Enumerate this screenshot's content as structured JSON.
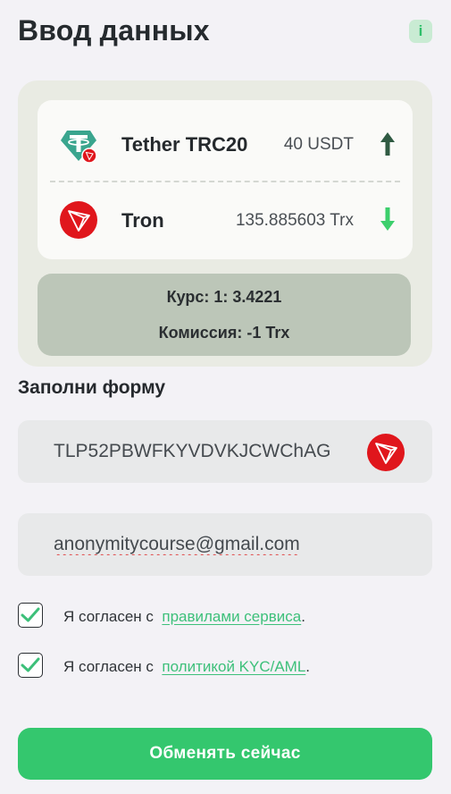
{
  "header": {
    "title": "Ввод данных",
    "info_label": "i"
  },
  "exchange": {
    "from": {
      "name": "Tether TRC20",
      "amount": "40 USDT",
      "icon": "tether-trc20-icon",
      "direction": "up"
    },
    "to": {
      "name": "Tron",
      "amount": "135.885603 Trx",
      "icon": "tron-icon",
      "direction": "down"
    },
    "rate_text": "Курс: 1: 3.4221",
    "fee_text": "Комиссия: -1 Trx"
  },
  "form": {
    "title": "Заполни форму",
    "wallet_value": "TLP52PBWFKYVDVKJCWChAG",
    "email_value": "anonymitycourse@gmail.com",
    "agreements": [
      {
        "prefix": "Я согласен с",
        "link": "правилами сервиса",
        "suffix": ".",
        "checked": true
      },
      {
        "prefix": "Я согласен с",
        "link": "политикой KYC/AML",
        "suffix": ".",
        "checked": true
      }
    ],
    "submit_label": "Обменять сейчас"
  },
  "colors": {
    "accent": "#34c76e",
    "link": "#3dc07a",
    "tron_red": "#e0161c",
    "tether_green": "#3aa58e",
    "arrow_up": "#2f5a42",
    "arrow_down": "#3ccf6c"
  }
}
